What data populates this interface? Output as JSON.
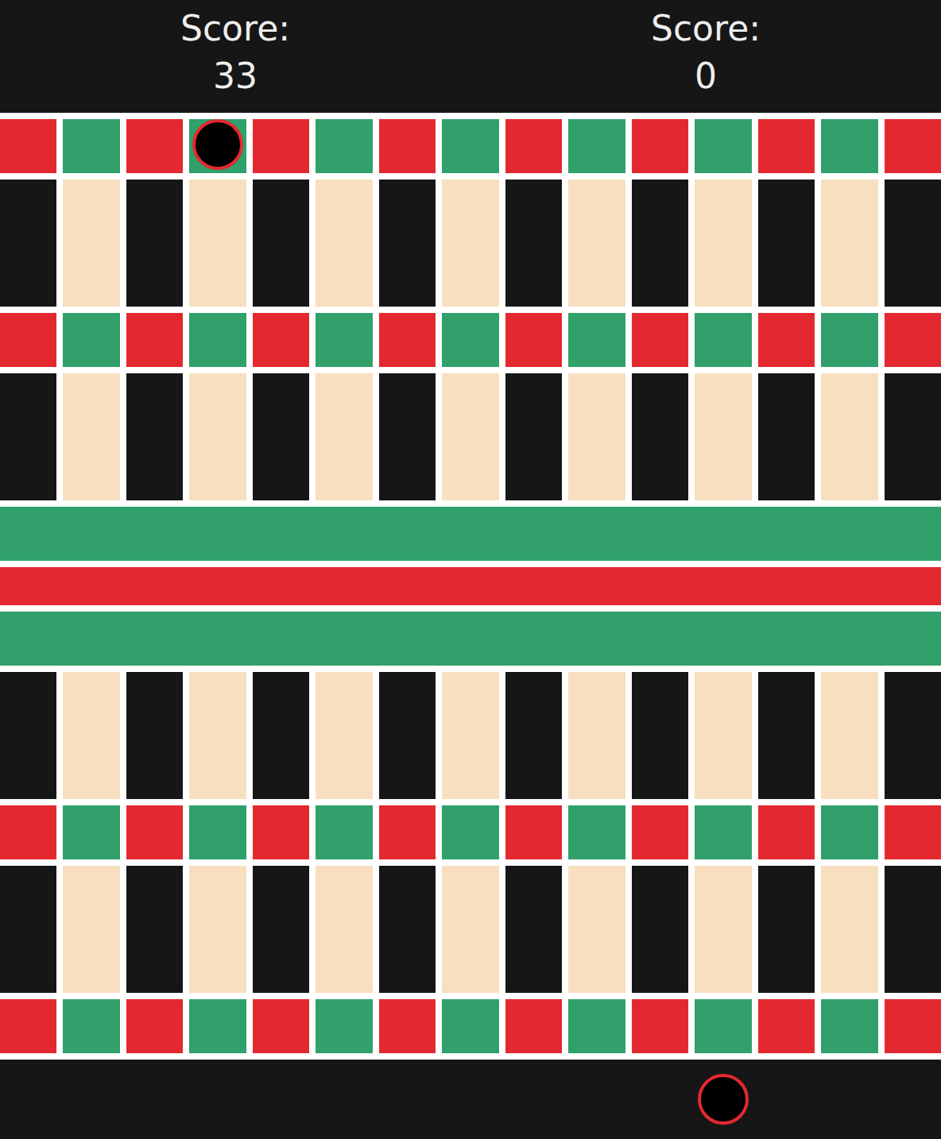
{
  "scoreboard": [
    {
      "label": "Score:",
      "score": "33"
    },
    {
      "label": "Score:",
      "score": "0"
    }
  ],
  "board": {
    "columns": 15,
    "lanes": [
      {
        "kind": "tiles",
        "colors": [
          "#e3292f",
          "#31a06b"
        ]
      },
      {
        "kind": "road",
        "colors": [
          "#161616",
          "#f8dfbf"
        ]
      },
      {
        "kind": "tiles",
        "colors": [
          "#e3292f",
          "#31a06b"
        ]
      },
      {
        "kind": "road",
        "colors": [
          "#161616",
          "#f8dfbf"
        ]
      },
      {
        "kind": "band",
        "colors": [
          "#31a06b"
        ]
      },
      {
        "kind": "strip",
        "colors": [
          "#e3292f"
        ]
      },
      {
        "kind": "band",
        "colors": [
          "#31a06b"
        ]
      },
      {
        "kind": "road",
        "colors": [
          "#161616",
          "#f8dfbf"
        ]
      },
      {
        "kind": "tiles",
        "colors": [
          "#e3292f",
          "#31a06b"
        ]
      },
      {
        "kind": "road",
        "colors": [
          "#161616",
          "#f8dfbf"
        ]
      },
      {
        "kind": "tiles",
        "colors": [
          "#e3292f",
          "#31a06b"
        ]
      }
    ]
  },
  "tokens": [
    {
      "player": 0,
      "zone": "lane-0",
      "column": 3
    },
    {
      "player": 1,
      "zone": "home",
      "column": 11
    }
  ]
}
